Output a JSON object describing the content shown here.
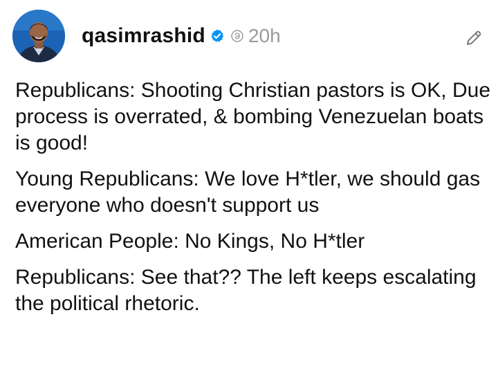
{
  "post": {
    "author": {
      "username": "qasimrashid",
      "avatar_icon": "profile-photo",
      "verified_icon": "verified-badge-icon",
      "verified_color": "#0095f6"
    },
    "threads_icon": "threads-logo-icon",
    "time": "20h",
    "edit_icon": "pencil-icon",
    "paragraphs": [
      "Republicans: Shooting Christian pastors is OK, Due process is overrated, & bombing Venezuelan boats is good!",
      "Young Republicans: We love H*tler, we should gas everyone who doesn't support us",
      "American People: No Kings, No H*tler",
      "Republicans: See that?? The left keeps escalating the political rhetoric."
    ]
  }
}
